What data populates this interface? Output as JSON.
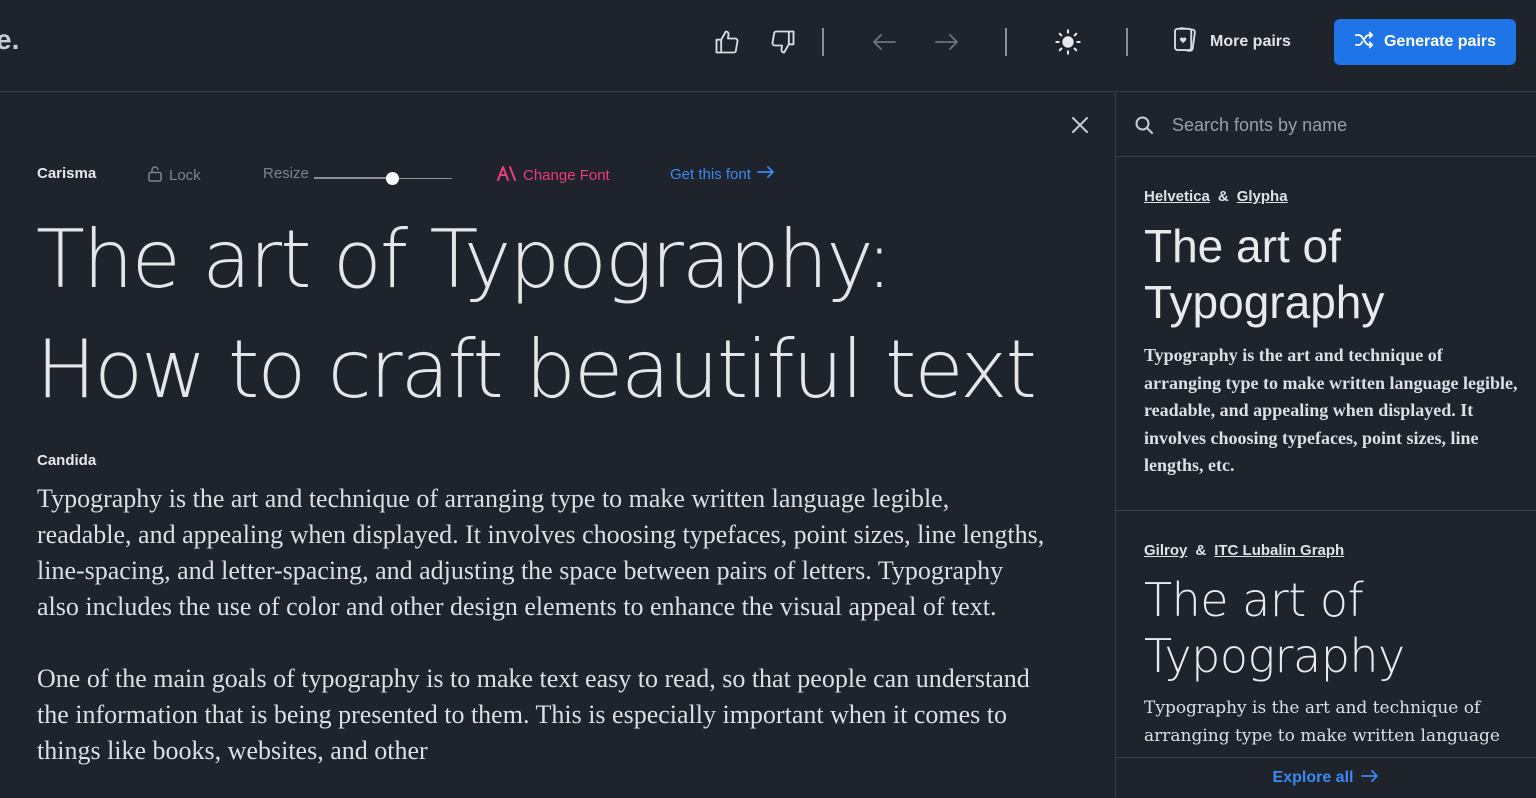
{
  "app": {
    "logo_text": "e."
  },
  "toolbar": {
    "like_icon": "thumbs-up-icon",
    "dislike_icon": "thumbs-down-icon",
    "prev_icon": "arrow-left-icon",
    "next_icon": "arrow-right-icon",
    "theme_icon": "sun-icon",
    "more_pairs_label": "More pairs",
    "generate_label": "Generate pairs",
    "accent_color": "#1f75e8"
  },
  "editor": {
    "heading_font": "Carisma",
    "lock_label": "Lock",
    "resize_label": "Resize",
    "change_font_label": "Change Font",
    "get_font_label": "Get this font",
    "headline_line1": "The art of Typography:",
    "headline_line2": "How to craft beautiful text",
    "body_font": "Candida",
    "paragraphs": [
      "Typography is the art and technique of arranging type to make written language legible, readable, and appealing when displayed. It involves choosing typefaces, point sizes, line lengths, line-spacing, and letter-spacing, and adjusting the space between pairs of letters. Typography also includes the use of color and other design elements to enhance the visual appeal of text.",
      "One of the main goals of typography is to make text easy to read, so that people can understand the information that is being presented to them. This is especially important when it comes to things like books, websites, and other"
    ],
    "change_font_color": "#ec3c7a",
    "link_color": "#3b8af0"
  },
  "sidebar": {
    "search_placeholder": "Search fonts by name",
    "pairs": [
      {
        "heading_font": "Helvetica",
        "body_font": "Glypha",
        "separator": "&",
        "title": "The art of Typography",
        "body": "Typography is the art and technique of arranging type to make written language legible, readable, and appealing when displayed. It involves choosing typefaces, point sizes, line lengths, etc."
      },
      {
        "heading_font": "Gilroy",
        "body_font": "ITC Lubalin Graph",
        "separator": "&",
        "title": "The art of Typography",
        "body": "Typography is the art and technique of arranging type to make written language"
      }
    ],
    "explore_label": "Explore all"
  }
}
